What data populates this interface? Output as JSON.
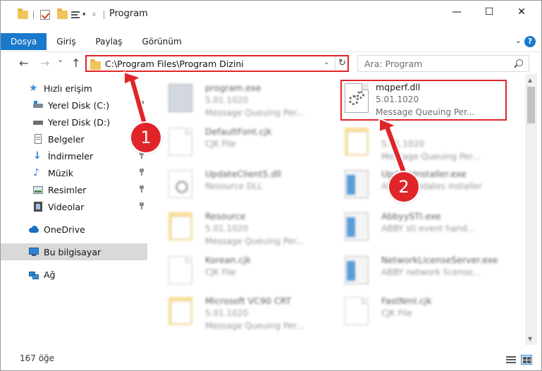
{
  "window": {
    "title": "Program",
    "minimize_label": "—",
    "maximize_label": "☐",
    "close_label": "✕"
  },
  "ribbon": {
    "tabs": [
      {
        "label": "Dosya"
      },
      {
        "label": "Giriş"
      },
      {
        "label": "Paylaş"
      },
      {
        "label": "Görünüm"
      }
    ],
    "help_label": "?"
  },
  "navbar": {
    "back_label": "←",
    "forward_label": "→",
    "dropdown_label": "⌄",
    "up_label": "↑",
    "address": "C:\\Program Files\\Program Dizini",
    "refresh_label": "↻",
    "search_placeholder": "Ara: Program"
  },
  "sidebar": {
    "items": [
      {
        "label": "Hızlı erişim",
        "icon": "star-icon"
      },
      {
        "label": "Yerel Disk (C:)",
        "icon": "drive-icon"
      },
      {
        "label": "Yerel Disk (D:)",
        "icon": "drive-icon"
      },
      {
        "label": "Belgeler",
        "icon": "documents-icon"
      },
      {
        "label": "İndirmeler",
        "icon": "download-icon"
      },
      {
        "label": "Müzik",
        "icon": "music-icon"
      },
      {
        "label": "Resimler",
        "icon": "pictures-icon"
      },
      {
        "label": "Videolar",
        "icon": "videos-icon"
      },
      {
        "label": "OneDrive",
        "icon": "cloud-icon"
      },
      {
        "label": "Bu bilgisayar",
        "icon": "computer-icon"
      },
      {
        "label": "Ağ",
        "icon": "network-icon"
      }
    ]
  },
  "files": {
    "left": [
      {
        "name": "program.exe",
        "line2": "5.01.1020",
        "line3": "Message Queuing Per...",
        "icon": "exe-icon"
      },
      {
        "name": "DefaultFont.cjk",
        "line2": "CJK File",
        "line3": "",
        "icon": "document-icon"
      },
      {
        "name": "UpdateClient5.dll",
        "line2": "Resource DLL",
        "line3": "",
        "icon": "dll-gear-icon"
      },
      {
        "name": "Resource",
        "line2": "5.01.1020",
        "line3": "Message Queuing Per...",
        "icon": "folder-icon"
      },
      {
        "name": "Korean.cjk",
        "line2": "CJK File",
        "line3": "",
        "icon": "document-icon"
      },
      {
        "name": "Microsoft VC90 CRT",
        "line2": "5.01.1020",
        "line3": "Message Queuing Per...",
        "icon": "folder-icon"
      }
    ],
    "right": [
      {
        "name": "",
        "line2": "5.01.1020",
        "line3": "Message Queuing Per...",
        "icon": "folder-icon"
      },
      {
        "name": "UpdateInstaller.exe",
        "line2": "ABBYY updates installer",
        "line3": "",
        "icon": "app-icon"
      },
      {
        "name": "AbbyySTI.exe",
        "line2": "ABBY sti event hand...",
        "line3": "",
        "icon": "app-icon"
      },
      {
        "name": "NetworkLicenseServer.exe",
        "line2": "ABBY network license...",
        "line3": "",
        "icon": "app-icon"
      },
      {
        "name": "FastNml.cjk",
        "line2": "CJK File",
        "line3": "",
        "icon": "document-icon"
      }
    ],
    "highlighted": {
      "name": "mqperf.dll",
      "line2": "5.01.1020",
      "line3": "Message Queuing Per...",
      "icon": "dll-gear-icon"
    }
  },
  "status": {
    "count": "167 öğe"
  },
  "annotations": [
    {
      "label": "1"
    },
    {
      "label": "2"
    }
  ],
  "colors": {
    "accent": "#1979ca",
    "highlight_red": "#e0252a",
    "selection": "#d9d9d9"
  }
}
